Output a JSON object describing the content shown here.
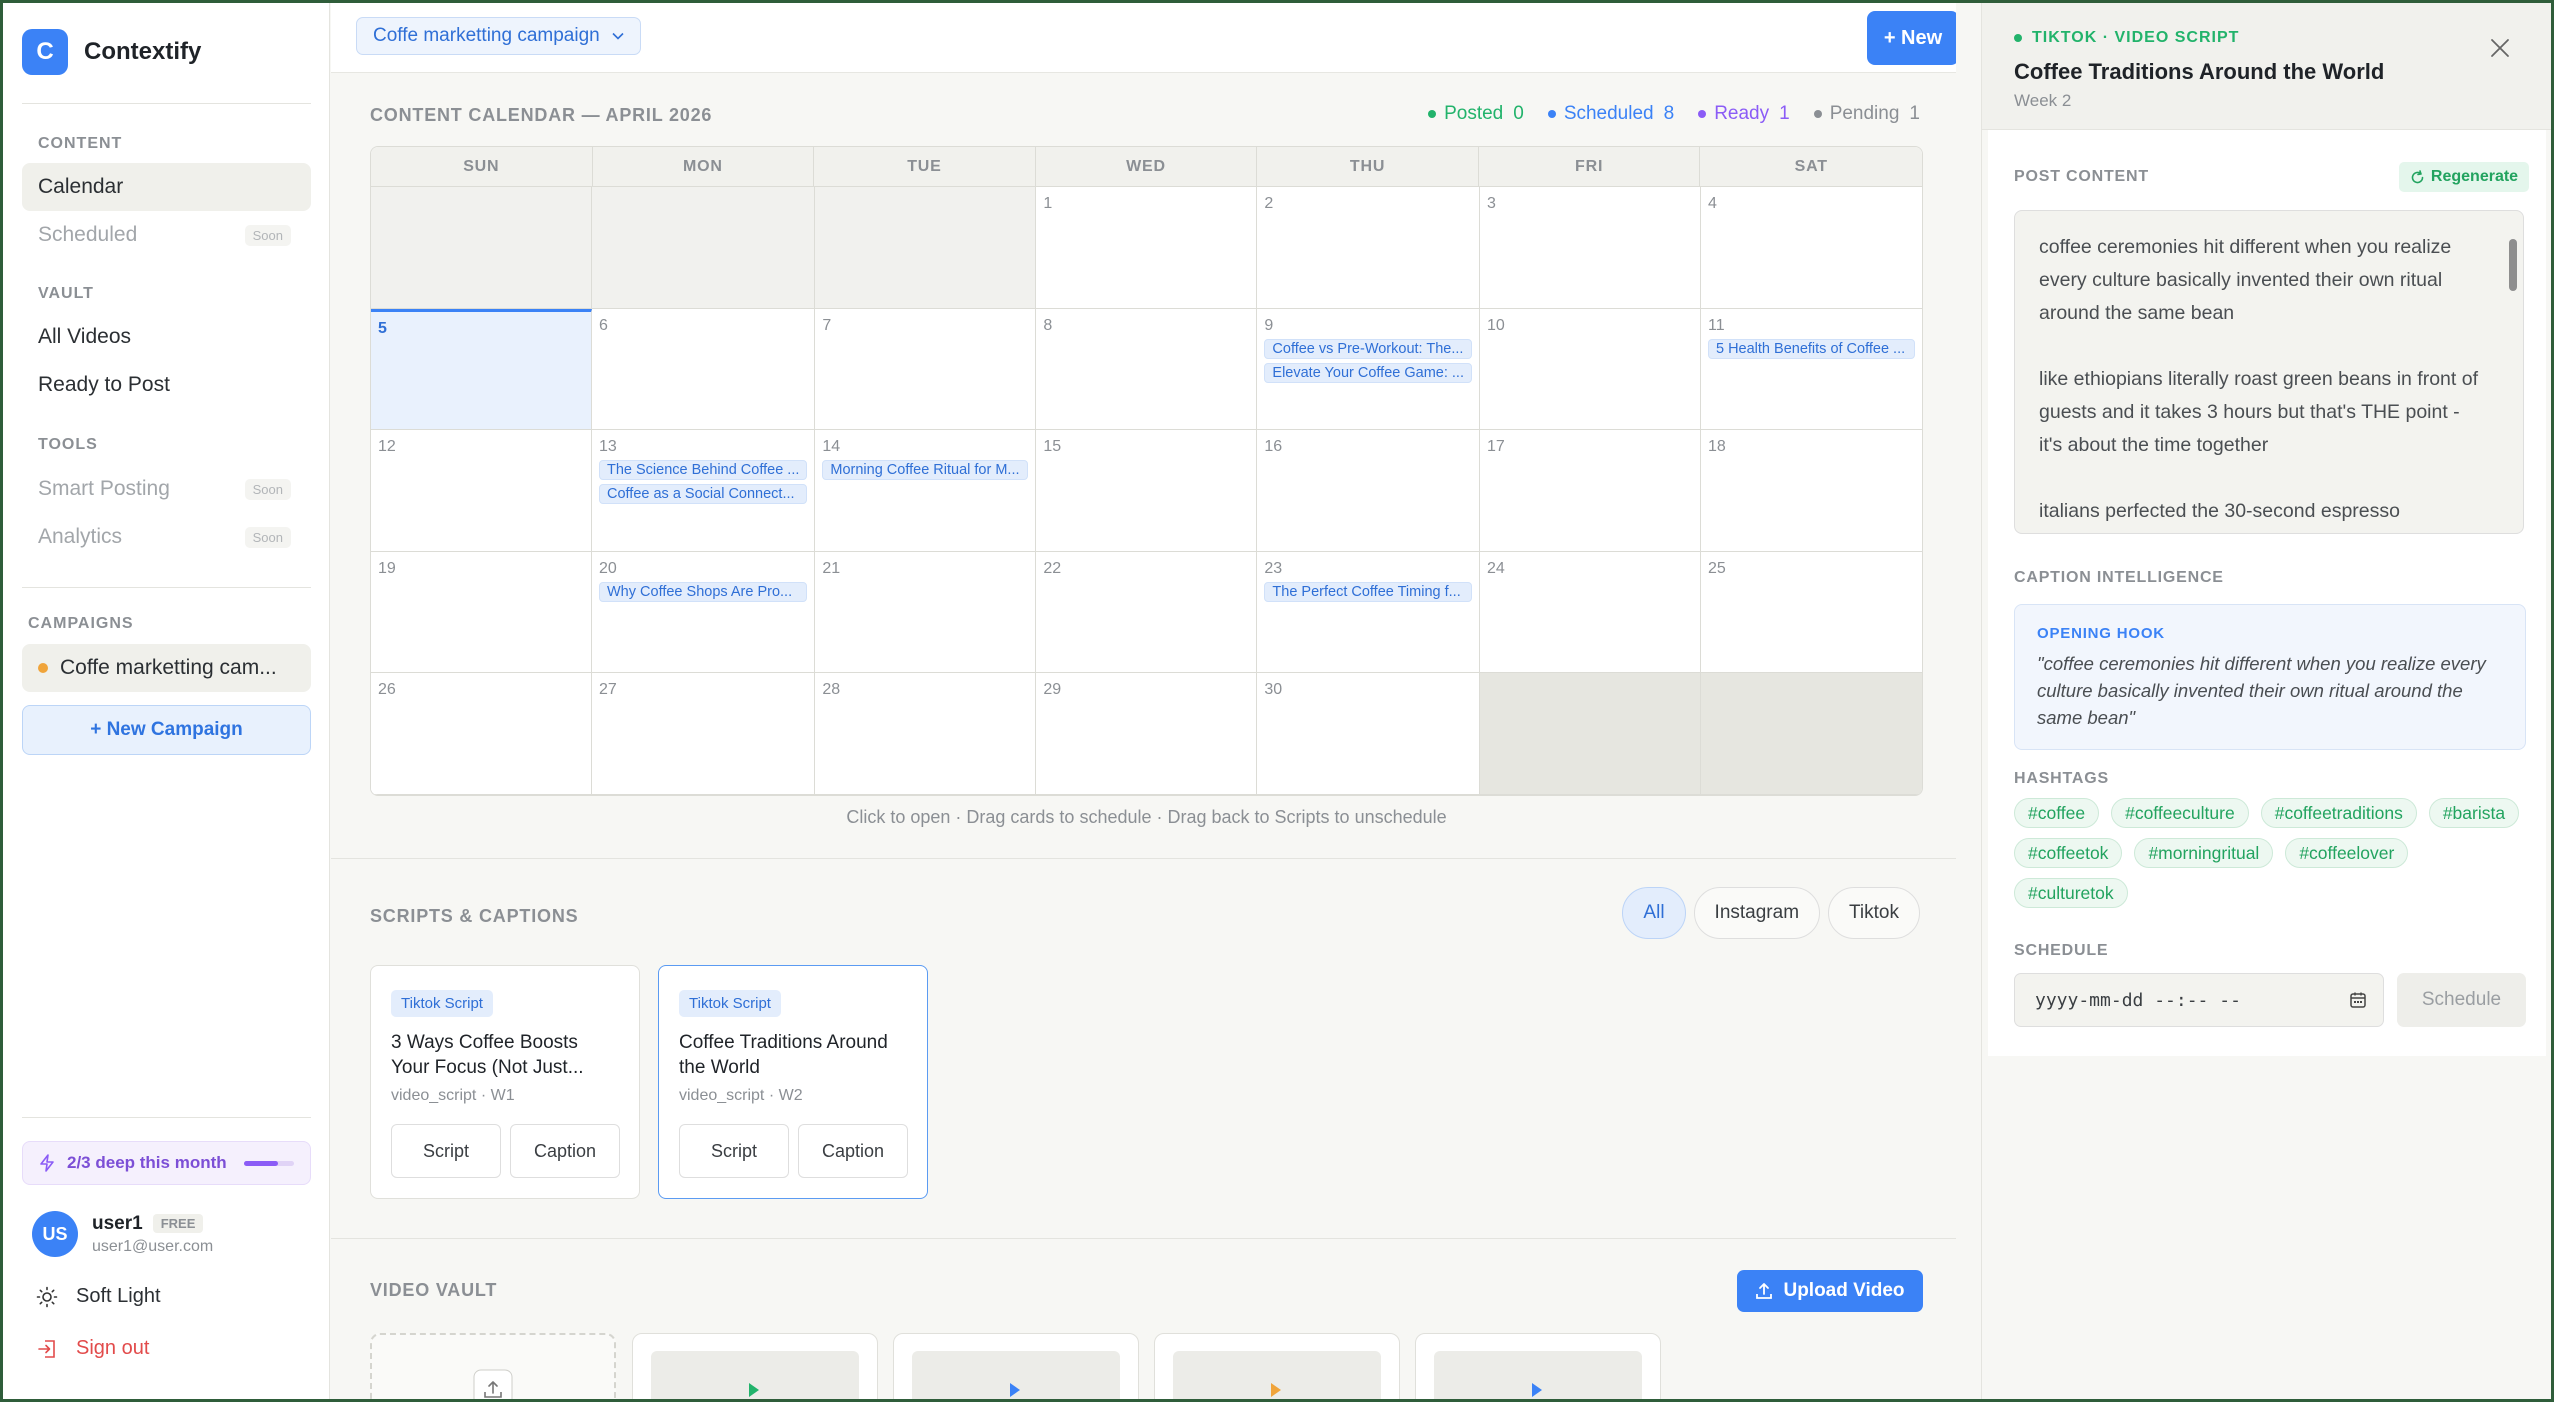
{
  "app": {
    "logo_letter": "C",
    "name": "Contextify"
  },
  "sidebar": {
    "sections": {
      "content": "CONTENT",
      "vault": "VAULT",
      "tools": "TOOLS",
      "campaigns": "CAMPAIGNS"
    },
    "items": {
      "calendar": "Calendar",
      "scheduled": "Scheduled",
      "all_videos": "All Videos",
      "ready_to_post": "Ready to Post",
      "smart_posting": "Smart Posting",
      "analytics": "Analytics"
    },
    "soon_label": "Soon",
    "campaign_name": "Coffe marketting cam...",
    "new_campaign": "+ New Campaign",
    "usage": {
      "label": "2/3 deep this month",
      "fraction": 0.67
    },
    "user": {
      "initials": "US",
      "name": "user1",
      "plan": "FREE",
      "email": "user1@user.com"
    },
    "theme_label": "Soft Light",
    "signout_label": "Sign out"
  },
  "topbar": {
    "campaign_select": "Coffe marketting campaign",
    "new_button": "+ New"
  },
  "calendar": {
    "title": "CONTENT CALENDAR — APRIL 2026",
    "legend": [
      {
        "label": "Posted",
        "count": "0",
        "color": "#22b36b"
      },
      {
        "label": "Scheduled",
        "count": "8",
        "color": "#3b82f6"
      },
      {
        "label": "Ready",
        "count": "1",
        "color": "#8b5cf6"
      },
      {
        "label": "Pending",
        "count": "1",
        "color": "#8b8f94"
      }
    ],
    "weekdays": [
      "SUN",
      "MON",
      "TUE",
      "WED",
      "THU",
      "FRI",
      "SAT"
    ],
    "cells": [
      {
        "day": "",
        "kind": "empty",
        "events": []
      },
      {
        "day": "",
        "kind": "empty",
        "events": []
      },
      {
        "day": "",
        "kind": "empty",
        "events": []
      },
      {
        "day": "1",
        "events": []
      },
      {
        "day": "2",
        "events": []
      },
      {
        "day": "3",
        "events": []
      },
      {
        "day": "4",
        "events": []
      },
      {
        "day": "5",
        "kind": "today",
        "events": []
      },
      {
        "day": "6",
        "events": []
      },
      {
        "day": "7",
        "events": []
      },
      {
        "day": "8",
        "events": []
      },
      {
        "day": "9",
        "events": [
          "Coffee vs Pre-Workout: The...",
          "Elevate Your Coffee Game: ..."
        ]
      },
      {
        "day": "10",
        "events": []
      },
      {
        "day": "11",
        "events": [
          "5 Health Benefits of Coffee ..."
        ]
      },
      {
        "day": "12",
        "events": []
      },
      {
        "day": "13",
        "events": [
          "The Science Behind Coffee ...",
          "Coffee as a Social Connect..."
        ]
      },
      {
        "day": "14",
        "events": [
          "Morning Coffee Ritual for M..."
        ]
      },
      {
        "day": "15",
        "events": []
      },
      {
        "day": "16",
        "events": []
      },
      {
        "day": "17",
        "events": []
      },
      {
        "day": "18",
        "events": []
      },
      {
        "day": "19",
        "events": []
      },
      {
        "day": "20",
        "events": [
          "Why Coffee Shops Are Pro..."
        ]
      },
      {
        "day": "21",
        "events": []
      },
      {
        "day": "22",
        "events": []
      },
      {
        "day": "23",
        "events": [
          "The Perfect Coffee Timing f..."
        ]
      },
      {
        "day": "24",
        "events": []
      },
      {
        "day": "25",
        "events": []
      },
      {
        "day": "26",
        "events": []
      },
      {
        "day": "27",
        "events": []
      },
      {
        "day": "28",
        "events": []
      },
      {
        "day": "29",
        "events": []
      },
      {
        "day": "30",
        "events": []
      },
      {
        "day": "",
        "kind": "pad",
        "events": []
      },
      {
        "day": "",
        "kind": "pad",
        "events": []
      }
    ],
    "hint": "Click to open · Drag cards to schedule · Drag back to Scripts to unschedule"
  },
  "scripts": {
    "title": "SCRIPTS & CAPTIONS",
    "filters": [
      "All",
      "Instagram",
      "Tiktok"
    ],
    "cards": [
      {
        "badge": "Tiktok Script",
        "title": "3 Ways Coffee Boosts Your Focus (Not Just...",
        "meta": "video_script · W1",
        "script_btn": "Script",
        "caption_btn": "Caption"
      },
      {
        "badge": "Tiktok Script",
        "title": "Coffee Traditions Around the World",
        "meta": "video_script · W2",
        "script_btn": "Script",
        "caption_btn": "Caption"
      }
    ]
  },
  "vault": {
    "title": "VIDEO VAULT",
    "upload_button": "Upload Video"
  },
  "panel": {
    "kicker": "TIKTOK · VIDEO SCRIPT",
    "title": "Coffee Traditions Around the World",
    "subtitle": "Week 2",
    "post_content_label": "POST CONTENT",
    "regenerate": "Regenerate",
    "post_content": "coffee ceremonies hit different when you realize every culture basically invented their own ritual around the same bean\n\nlike ethiopians literally roast green beans in front of guests and it takes 3 hours but that's THE point - it's about the time together\n\nitalians perfected the 30-second espresso",
    "caption_label": "CAPTION INTELLIGENCE",
    "hook_label": "OPENING HOOK",
    "hook_text": "\"coffee ceremonies hit different when you realize every culture basically invented their own ritual around the same bean\"",
    "hashtags_label": "HASHTAGS",
    "hashtags": [
      "#coffee",
      "#coffeeculture",
      "#coffeetraditions",
      "#barista",
      "#coffeetok",
      "#morningritual",
      "#coffeelover",
      "#culturetok"
    ],
    "schedule_label": "SCHEDULE",
    "schedule_placeholder": "yyyy-mm-dd --:-- --",
    "schedule_button": "Schedule"
  }
}
